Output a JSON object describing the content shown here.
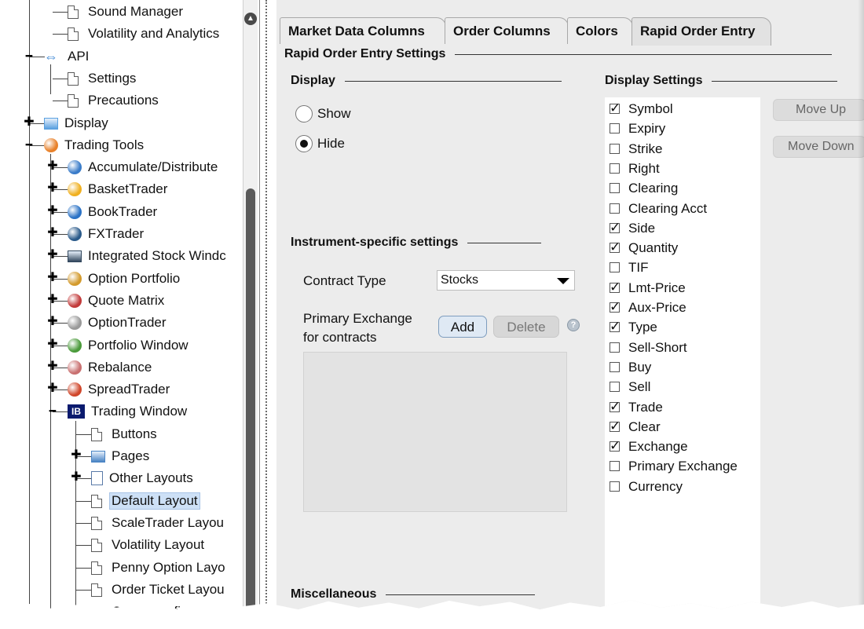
{
  "tree": {
    "items": [
      {
        "label": "Sound Manager",
        "icon": "page-icon"
      },
      {
        "label": "Volatility and Analytics",
        "icon": "page-icon"
      },
      {
        "label": "API",
        "icon": "api-arrows-icon"
      },
      {
        "label": "Settings",
        "icon": "page-icon"
      },
      {
        "label": "Precautions",
        "icon": "page-icon"
      },
      {
        "label": "Display",
        "icon": "display-icon"
      },
      {
        "label": "Trading Tools",
        "icon": "trading-tools-icon"
      },
      {
        "label": "Accumulate/Distribute",
        "icon": "accumulate-distribute-icon"
      },
      {
        "label": "BasketTrader",
        "icon": "basket-trader-icon"
      },
      {
        "label": "BookTrader",
        "icon": "book-trader-icon"
      },
      {
        "label": "FXTrader",
        "icon": "fx-trader-icon"
      },
      {
        "label": "Integrated Stock Windc",
        "icon": "integrated-stock-window-icon"
      },
      {
        "label": "Option Portfolio",
        "icon": "option-portfolio-icon"
      },
      {
        "label": "Quote Matrix",
        "icon": "quote-matrix-icon"
      },
      {
        "label": "OptionTrader",
        "icon": "option-trader-icon"
      },
      {
        "label": "Portfolio Window",
        "icon": "portfolio-window-icon"
      },
      {
        "label": "Rebalance",
        "icon": "rebalance-icon"
      },
      {
        "label": "SpreadTrader",
        "icon": "spread-trader-icon"
      },
      {
        "label": "Trading Window",
        "icon": "ib-logo-icon",
        "icon_text": "IB"
      },
      {
        "label": "Buttons",
        "icon": "page-icon"
      },
      {
        "label": "Pages",
        "icon": "pages-icon"
      },
      {
        "label": "Other Layouts",
        "icon": "other-layouts-icon"
      },
      {
        "label": "Default Layout",
        "icon": "page-icon"
      },
      {
        "label": "ScaleTrader Layou",
        "icon": "page-icon"
      },
      {
        "label": "Volatility Layout",
        "icon": "page-icon"
      },
      {
        "label": "Penny Option Layo",
        "icon": "page-icon"
      },
      {
        "label": "Order Ticket Layou",
        "icon": "page-icon"
      },
      {
        "label": "Order Confirm Lay",
        "icon": "page-icon"
      }
    ],
    "selected": "Default Layout"
  },
  "tabs": [
    {
      "label": "Market Data Columns"
    },
    {
      "label": "Order Columns"
    },
    {
      "label": "Colors"
    },
    {
      "label": "Rapid Order Entry",
      "active": true
    }
  ],
  "rapid_order_entry": {
    "title": "Rapid Order Entry Settings",
    "display": {
      "title": "Display",
      "options": [
        {
          "label": "Show",
          "selected": false
        },
        {
          "label": "Hide",
          "selected": true
        }
      ]
    },
    "instrument": {
      "title": "Instrument-specific settings",
      "contract_type_label": "Contract Type",
      "contract_type_value": "Stocks",
      "primary_exchange_label_1": "Primary Exchange",
      "primary_exchange_label_2": "for contracts",
      "add_label": "Add",
      "delete_label": "Delete"
    },
    "misc_title": "Miscellaneous",
    "display_settings": {
      "title": "Display Settings",
      "move_up_label": "Move Up",
      "move_down_label": "Move Down",
      "items": [
        {
          "label": "Symbol",
          "checked": true
        },
        {
          "label": "Expiry",
          "checked": false
        },
        {
          "label": "Strike",
          "checked": false
        },
        {
          "label": "Right",
          "checked": false
        },
        {
          "label": "Clearing",
          "checked": false
        },
        {
          "label": "Clearing Acct",
          "checked": false
        },
        {
          "label": "Side",
          "checked": true
        },
        {
          "label": "Quantity",
          "checked": true
        },
        {
          "label": "TIF",
          "checked": false
        },
        {
          "label": "Lmt-Price",
          "checked": true
        },
        {
          "label": "Aux-Price",
          "checked": true
        },
        {
          "label": "Type",
          "checked": true
        },
        {
          "label": "Sell-Short",
          "checked": false
        },
        {
          "label": "Buy",
          "checked": false
        },
        {
          "label": "Sell",
          "checked": false
        },
        {
          "label": "Trade",
          "checked": true
        },
        {
          "label": "Clear",
          "checked": true
        },
        {
          "label": "Exchange",
          "checked": true
        },
        {
          "label": "Primary Exchange",
          "checked": false
        },
        {
          "label": "Currency",
          "checked": false
        }
      ]
    }
  },
  "colors": {
    "selected_bg": "#cde0f6",
    "add_button_bg": "#dfe9f4",
    "panel_bg": "#ececec"
  }
}
